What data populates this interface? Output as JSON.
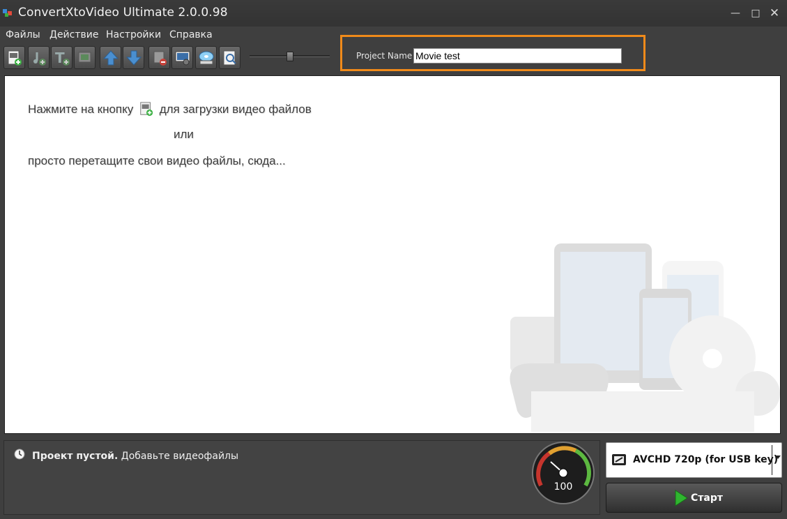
{
  "window": {
    "title": "ConvertXtoVideo Ultimate 2.0.0.98",
    "app_icon": "app-logo-icon"
  },
  "menu": {
    "items": [
      "Файлы",
      "Действие",
      "Настройки",
      "Справка"
    ]
  },
  "toolbar": {
    "buttons": [
      "add-video-icon",
      "add-audio-icon",
      "add-text-icon",
      "add-chapter-icon",
      "move-up-icon",
      "move-down-icon",
      "delete-icon",
      "preview-settings-icon",
      "burn-disc-icon",
      "search-preview-icon"
    ],
    "slider_level": 0.5
  },
  "project": {
    "label": "Project Name",
    "value": "Movie test"
  },
  "main": {
    "hint_prefix": "Нажмите на кнопку",
    "hint_suffix": "для загрузки видео файлов",
    "hint_or": "или",
    "hint_drag": "просто перетащите свои видео файлы, сюда..."
  },
  "status": {
    "title": "Проект пустой.",
    "message": "Добавьте видеофайлы",
    "icon": "clock-icon"
  },
  "gauge": {
    "value": "100",
    "icon": "speed-gauge-icon"
  },
  "format": {
    "selected": "AVCHD 720p (for USB key)",
    "icon": "device-icon"
  },
  "start": {
    "label": "Старт",
    "icon": "play-icon"
  },
  "colors": {
    "accent": "#f08a1a",
    "background": "#3f3f3f",
    "play": "#2fb52f"
  }
}
